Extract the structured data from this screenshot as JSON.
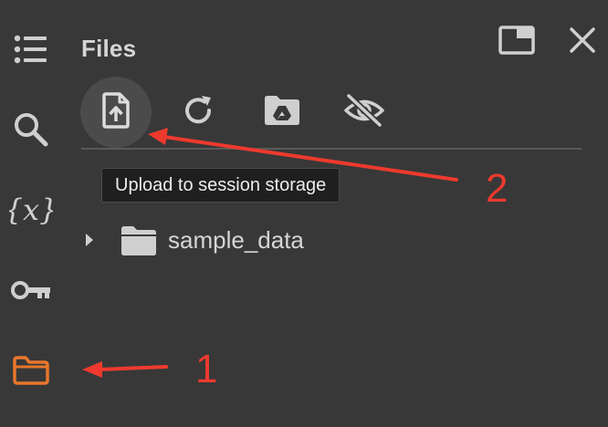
{
  "sidebar": {
    "icons": [
      {
        "name": "toc-icon"
      },
      {
        "name": "search-icon"
      },
      {
        "name": "variables-icon"
      },
      {
        "name": "secrets-key-icon"
      },
      {
        "name": "files-folder-icon",
        "active": true,
        "color": "#e8762b"
      }
    ]
  },
  "panel": {
    "title": "Files",
    "window_controls": [
      "open-in-tab-icon",
      "close-icon"
    ]
  },
  "toolbar": {
    "buttons": [
      {
        "name": "upload-icon",
        "active": true
      },
      {
        "name": "refresh-icon"
      },
      {
        "name": "mount-drive-icon"
      },
      {
        "name": "hide-hidden-files-icon"
      }
    ],
    "tooltip": "Upload to session storage"
  },
  "file_tree": {
    "items": [
      {
        "label": "sample_data",
        "type": "folder",
        "expanded": false
      }
    ]
  },
  "annotations": {
    "label_1": "1",
    "label_2": "2",
    "arrow_color": "#ee3a2e"
  },
  "colors": {
    "background": "#383838",
    "icon": "#cfcfcf",
    "accent_orange": "#e8762b",
    "annotation_red": "#ee3a2e"
  }
}
